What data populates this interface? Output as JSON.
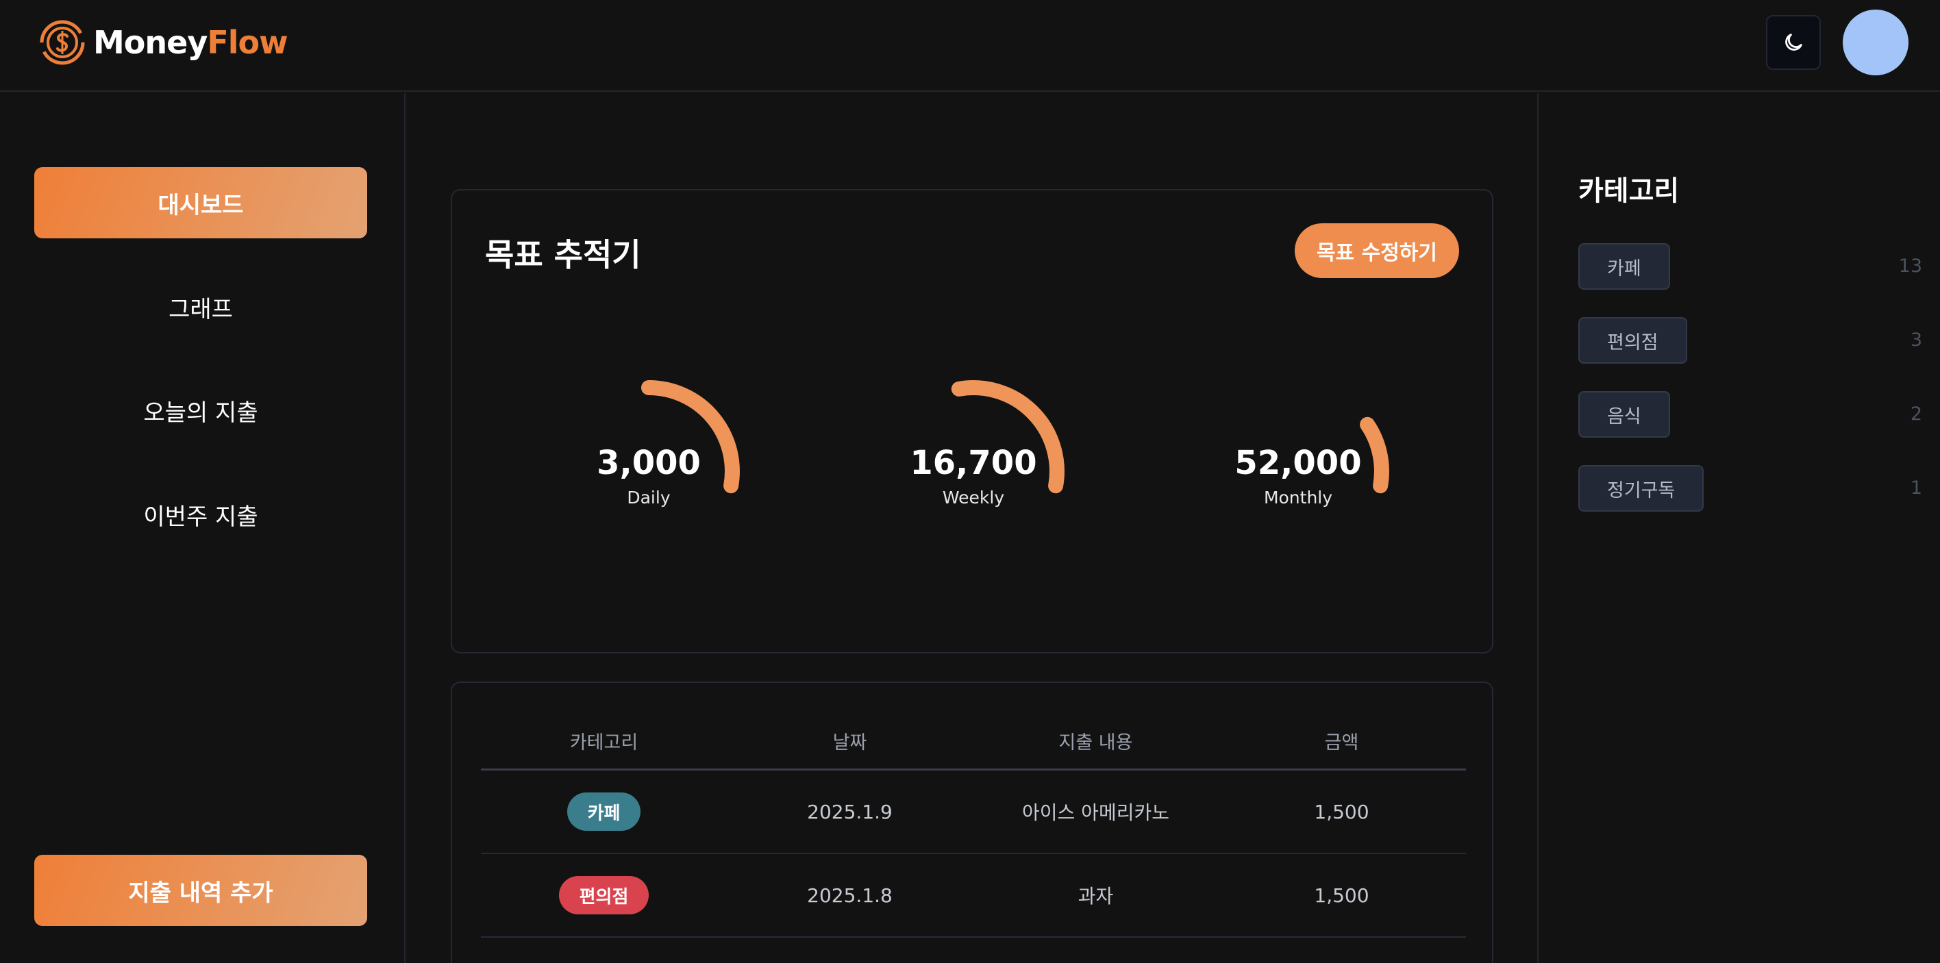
{
  "app": {
    "brand_part1": "Money",
    "brand_part2": "Flow",
    "brand_color": "#ef7f38",
    "theme_icon": "moon-icon",
    "avatar_color": "#a3c4f8"
  },
  "sidebar": {
    "items": [
      {
        "label": "대시보드",
        "active": true
      },
      {
        "label": "그래프",
        "active": false
      },
      {
        "label": "오늘의 지출",
        "active": false
      },
      {
        "label": "이번주 지출",
        "active": false
      }
    ],
    "add_button": "지출 내역 추가"
  },
  "goal_tracker": {
    "title": "목표 추적기",
    "edit_button": "목표 수정하기",
    "gauges": [
      {
        "value": "3,000",
        "label": "Daily",
        "progress": 0.5
      },
      {
        "value": "16,700",
        "label": "Weekly",
        "progress": 0.55
      },
      {
        "value": "52,000",
        "label": "Monthly",
        "progress": 0.22
      }
    ],
    "gauge_color": "#f0955a"
  },
  "expenses": {
    "headers": [
      "카테고리",
      "날짜",
      "지출 내용",
      "금액"
    ],
    "rows": [
      {
        "category": "카페",
        "category_color": "#3a7d8c",
        "date": "2025.1.9",
        "description": "아이스 아메리카노",
        "amount": "1,500"
      },
      {
        "category": "편의점",
        "category_color": "#d9434e",
        "date": "2025.1.8",
        "description": "과자",
        "amount": "1,500"
      }
    ]
  },
  "categories": {
    "title": "카테고리",
    "items": [
      {
        "name": "카페",
        "count": "13"
      },
      {
        "name": "편의점",
        "count": "3"
      },
      {
        "name": "음식",
        "count": "2"
      },
      {
        "name": "정기구독",
        "count": "1"
      }
    ]
  }
}
